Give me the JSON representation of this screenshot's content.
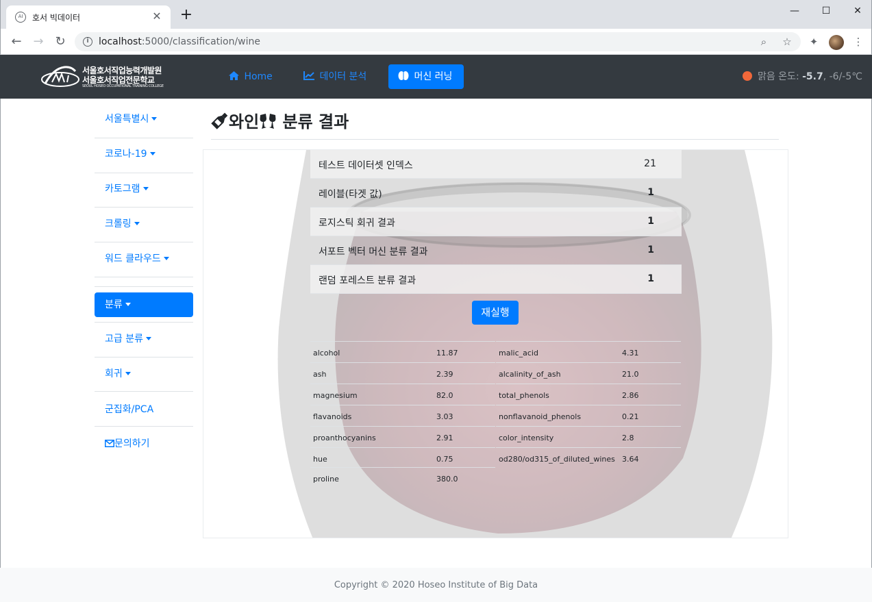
{
  "browser": {
    "tab_title": "호서 빅데이터",
    "favicon_text": "AI",
    "url_host": "localhost",
    "url_rest": ":5000/classification/wine",
    "newtab_symbol": "+",
    "minimize_symbol": "—",
    "maximize_symbol": "☐",
    "close_symbol": "✕"
  },
  "navbar": {
    "logo_line1": "서울호서직업능력개발원",
    "logo_line2": "서울호서직업전문학교",
    "logo_line3": "SEOUL HOSEO OCCUPATIONAL TRAINING COLLEGE",
    "links": [
      {
        "label": "Home",
        "icon": "home-icon"
      },
      {
        "label": "데이터 분석",
        "icon": "chart-icon"
      },
      {
        "label": "머신 러닝",
        "icon": "brain-icon"
      }
    ],
    "weather_label": "맑음 온도: ",
    "weather_temp": "-5.7",
    "weather_range": ", -6/-5℃"
  },
  "sidebar": {
    "items": [
      {
        "label": "서울특별시",
        "dropdown": true
      },
      {
        "label": "코로나-19",
        "dropdown": true
      },
      {
        "label": "카토그램",
        "dropdown": true
      },
      {
        "label": "크롤링",
        "dropdown": true
      },
      {
        "label": "워드 클라우드",
        "dropdown": true
      },
      {
        "label": "분류",
        "dropdown": true,
        "active": true
      },
      {
        "label": "고급 분류",
        "dropdown": true
      },
      {
        "label": "회귀",
        "dropdown": true
      },
      {
        "label": "군집화/PCA",
        "dropdown": false
      },
      {
        "label": "문의하기",
        "dropdown": false,
        "icon": "envelope-icon"
      }
    ]
  },
  "main": {
    "title": "와인",
    "title_suffix": " 분류 결과",
    "results": [
      {
        "label": "테스트 데이터셋 인덱스",
        "value": "21"
      },
      {
        "label": "레이블(타겟 값)",
        "value": "1"
      },
      {
        "label": "로지스틱 회귀 결과",
        "value": "1"
      },
      {
        "label": "서포트 벡터 머신 분류 결과",
        "value": "1"
      },
      {
        "label": "랜덤 포레스트 분류 결과",
        "value": "1"
      }
    ],
    "rerun_label": "재실행",
    "features": [
      {
        "name": "alcohol",
        "value": "11.87"
      },
      {
        "name": "malic_acid",
        "value": "4.31"
      },
      {
        "name": "ash",
        "value": "2.39"
      },
      {
        "name": "alcalinity_of_ash",
        "value": "21.0"
      },
      {
        "name": "magnesium",
        "value": "82.0"
      },
      {
        "name": "total_phenols",
        "value": "2.86"
      },
      {
        "name": "flavanoids",
        "value": "3.03"
      },
      {
        "name": "nonflavanoid_phenols",
        "value": "0.21"
      },
      {
        "name": "proanthocyanins",
        "value": "2.91"
      },
      {
        "name": "color_intensity",
        "value": "2.8"
      },
      {
        "name": "hue",
        "value": "0.75"
      },
      {
        "name": "od280/od315_of_diluted_wines",
        "value": "3.64"
      },
      {
        "name": "proline",
        "value": "380.0"
      }
    ]
  },
  "footer": {
    "text": "Copyright © 2020 Hoseo Institute of Big Data"
  },
  "colors": {
    "primary": "#007bff",
    "navbar_bg": "#343a40",
    "weather_dot": "#f1683a",
    "wine": "#8b1a2e"
  }
}
